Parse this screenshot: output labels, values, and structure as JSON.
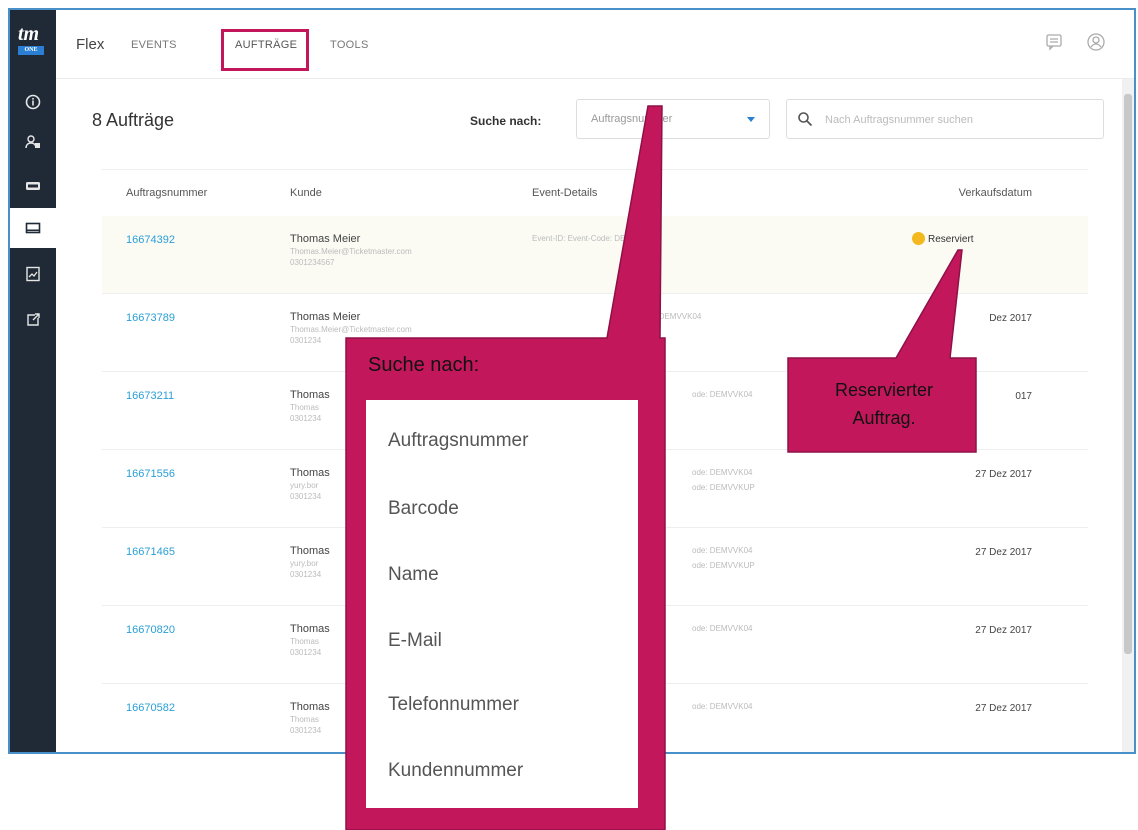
{
  "app": {
    "brand": "Flex",
    "logo_text": "tm",
    "logo_badge": "ONE",
    "nav": [
      {
        "label": "EVENTS",
        "active": false
      },
      {
        "label": "AUFTRÄGE",
        "active": true
      },
      {
        "label": "TOOLS",
        "active": false
      }
    ],
    "accent_color": "#2a7fd4",
    "highlight_color": "#c2185b"
  },
  "sidebar_icons": [
    "info-icon",
    "users-icon",
    "ticket-icon",
    "card-icon",
    "report-icon",
    "external-icon"
  ],
  "orders": {
    "count_label": "8 Aufträge",
    "search_by_label": "Suche nach:",
    "search_by_value": "Auftragsnummer",
    "search_placeholder": "Nach Auftragsnummer suchen",
    "columns": [
      "Auftragsnummer",
      "Kunde",
      "Event-Details",
      "Verkaufsdatum"
    ],
    "rows": [
      {
        "number": "16674392",
        "name": "Thomas Meier",
        "email": "Thomas.Meier@Ticketmaster.com",
        "phone": "0301234567",
        "event": "Event-ID:  Event-Code: DEMVVK04",
        "event2": "",
        "date": "",
        "status": "Reserviert"
      },
      {
        "number": "16673789",
        "name": "Thomas Meier",
        "email": "Thomas.Meier@Ticketmaster.com",
        "phone": "0301234",
        "event": "Event-Code: DEMVVK04",
        "event2": "",
        "date": "Dez 2017",
        "status": ""
      },
      {
        "number": "16673211",
        "name": "Thomas",
        "email": "Thomas",
        "phone": "0301234",
        "event": "ode: DEMVVK04",
        "event2": "",
        "date": "017",
        "status": ""
      },
      {
        "number": "16671556",
        "name": "Thomas",
        "email": "yury.bor",
        "phone": "0301234",
        "event": "ode: DEMVVK04",
        "event2": "ode: DEMVVKUP",
        "date": "27 Dez 2017",
        "status": ""
      },
      {
        "number": "16671465",
        "name": "Thomas",
        "email": "yury.bor",
        "phone": "0301234",
        "event": "ode: DEMVVK04",
        "event2": "ode: DEMVVKUP",
        "date": "27 Dez 2017",
        "status": ""
      },
      {
        "number": "16670820",
        "name": "Thomas",
        "email": "Thomas",
        "phone": "0301234",
        "event": "ode: DEMVVK04",
        "event2": "",
        "date": "27 Dez 2017",
        "status": ""
      },
      {
        "number": "16670582",
        "name": "Thomas",
        "email": "Thomas",
        "phone": "0301234",
        "event": "ode: DEMVVK04",
        "event2": "",
        "date": "27 Dez 2017",
        "status": ""
      }
    ]
  },
  "callouts": {
    "search_title": "Suche nach:",
    "search_options": [
      "Auftragsnummer",
      "Barcode",
      "Name",
      "E-Mail",
      "Telefonnummer",
      "Kundennummer"
    ],
    "reserved_line1": "Reservierter",
    "reserved_line2": "Auftrag."
  }
}
